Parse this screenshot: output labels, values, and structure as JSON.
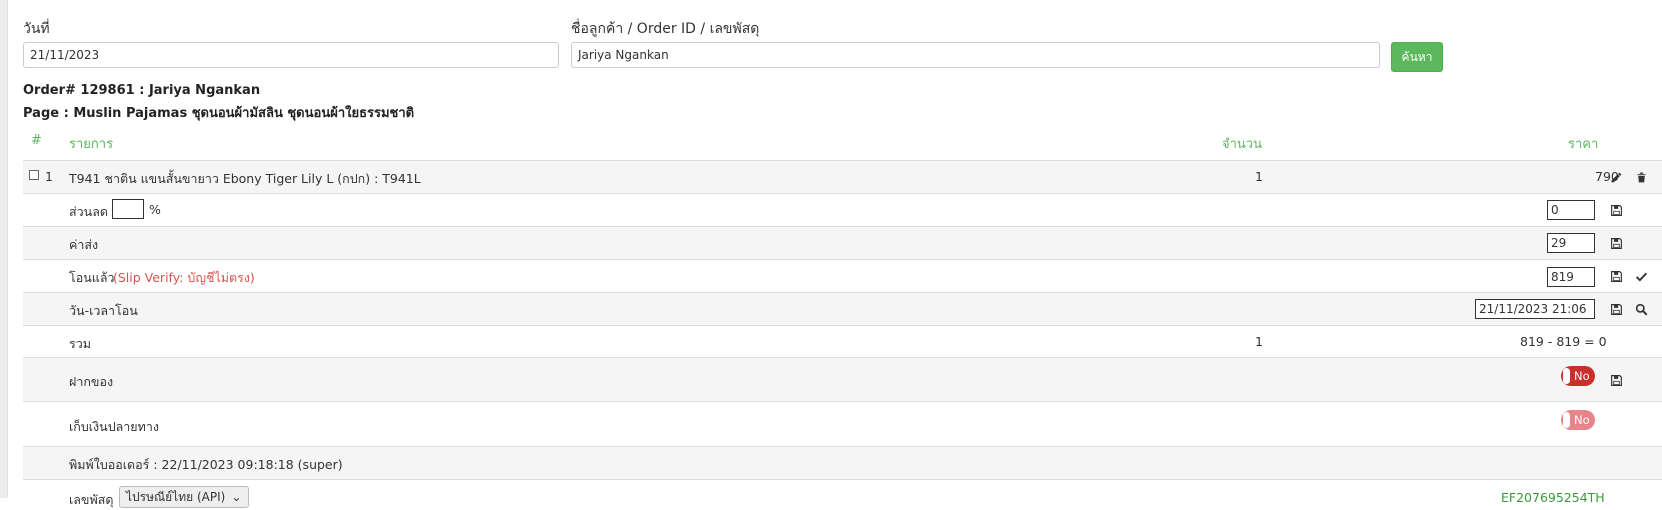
{
  "search": {
    "date_label": "วันที่",
    "date_value": "21/11/2023",
    "customer_label": "ชื่อลูกค้า / Order ID / เลขพัสดุ",
    "customer_value": "Jariya Ngankan",
    "search_button": "ค้นหา"
  },
  "order": {
    "title": "Order# 129861 : Jariya Ngankan",
    "page": "Page : Muslin Pajamas ชุดนอนผ้ามัสลิน ชุดนอนผ้าใยธรรมชาติ"
  },
  "table": {
    "headers": {
      "index": "#",
      "item": "รายการ",
      "qty": "จำนวน",
      "price": "ราคา"
    },
    "item": {
      "index": "1",
      "name": "T941 ชาติน แขนสั้นขายาว Ebony Tiger Lily L (กปก) : T941L",
      "qty": "1",
      "price": "790"
    },
    "discount": {
      "label": "ส่วนลด",
      "percent_sign": "%",
      "percent_value": "",
      "value": "0"
    },
    "shipping": {
      "label": "ค่าส่ง",
      "value": "29"
    },
    "transfer": {
      "label": "โอนแล้ว",
      "slip_note": "(Slip Verify: บัญชีไม่ตรง)",
      "value": "819"
    },
    "transfer_time": {
      "label": "วัน-เวลาโอน",
      "value": "21/11/2023 21:06"
    },
    "total": {
      "label": "รวม",
      "qty": "1",
      "calc": "819 - 819 = 0"
    },
    "deposit": {
      "label": "ฝากของ",
      "toggle": "No"
    },
    "cod": {
      "label": "เก็บเงินปลายทาง",
      "toggle": "No"
    },
    "printed": {
      "label": "พิมพ์ใบออเดอร์ : 22/11/2023 09:18:18 (super)"
    },
    "partial": {
      "label": "เลขพัสดุ",
      "select": "ไปรษณีย์ไทย (API)",
      "tracking": "EF207695254TH"
    }
  },
  "colors": {
    "accent_green": "#5cb85c",
    "danger_red": "#c9302c"
  }
}
